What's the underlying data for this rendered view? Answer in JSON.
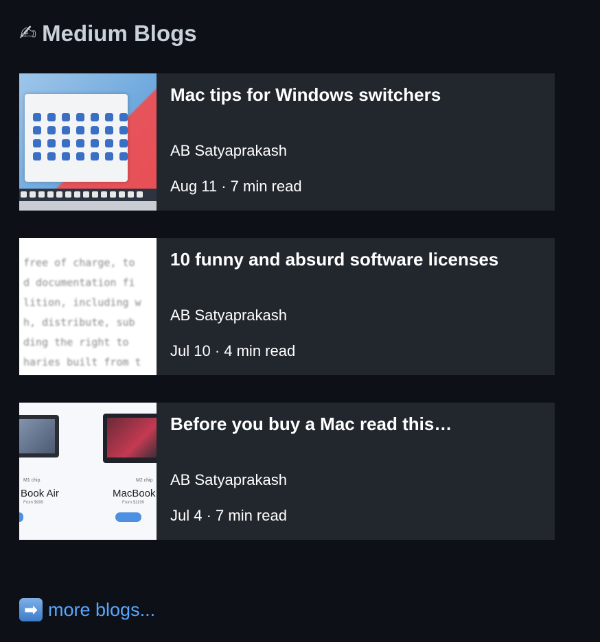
{
  "section": {
    "title": "Medium Blogs",
    "icon": "writing-hand-icon",
    "icon_glyph": "✍"
  },
  "posts": [
    {
      "title": "Mac tips for Windows switchers",
      "author": "AB Satyaprakash",
      "meta": "Aug 11 · 7 min read",
      "thumbnail": "mac-desktop-thumbnail"
    },
    {
      "title": "10 funny and absurd software licenses",
      "author": "AB Satyaprakash",
      "meta": "Jul 10 · 4 min read",
      "thumbnail": "license-text-thumbnail"
    },
    {
      "title": "Before you buy a Mac read this…",
      "author": "AB Satyaprakash",
      "meta": "Jul 4 · 7 min read",
      "thumbnail": "macbook-lineup-thumbnail"
    }
  ],
  "thumbs": {
    "license_text": "free of charge, to\nd documentation fi\nlition, including w\nh, distribute, sub\nding the right to\nharies built from t",
    "lineup": {
      "left_chip": "M1 chip",
      "left_name": "Book Air",
      "left_price": "From $999",
      "right_chip": "M2 chip",
      "right_name": "MacBook",
      "right_price": "From $1199"
    }
  },
  "more": {
    "label": "more blogs...",
    "icon": "right-arrow-icon",
    "icon_glyph": "➡"
  },
  "colors": {
    "background": "#0d1117",
    "card": "#22262d",
    "link": "#58a6ff"
  }
}
